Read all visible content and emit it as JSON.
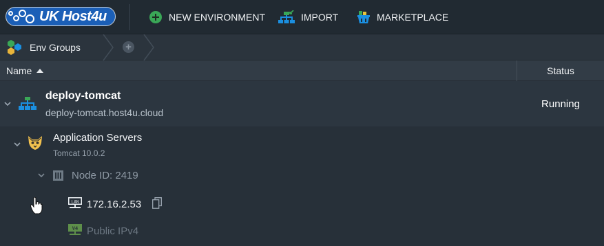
{
  "brand": {
    "logo_text": "UK Host4u"
  },
  "toolbar": {
    "new_environment": "NEW ENVIRONMENT",
    "import": "IMPORT",
    "marketplace": "MARKETPLACE"
  },
  "breadcrumb": {
    "env_groups": "Env Groups"
  },
  "table": {
    "col_name": "Name",
    "col_status": "Status"
  },
  "environment": {
    "name": "deploy-tomcat",
    "domain": "deploy-tomcat.host4u.cloud",
    "status": "Running"
  },
  "node_group": {
    "title": "Application Servers",
    "subtitle": "Tomcat 10.0.2",
    "node_id_label": "Node ID: 2419",
    "private_ip": "172.16.2.53",
    "public_ip_label": "Public IPv4"
  },
  "colors": {
    "background": "#273039",
    "toolbar": "#212a32",
    "accent_green": "#3aa757",
    "accent_blue": "#1b8fe0",
    "logo_blue": "#1b5fb7"
  }
}
